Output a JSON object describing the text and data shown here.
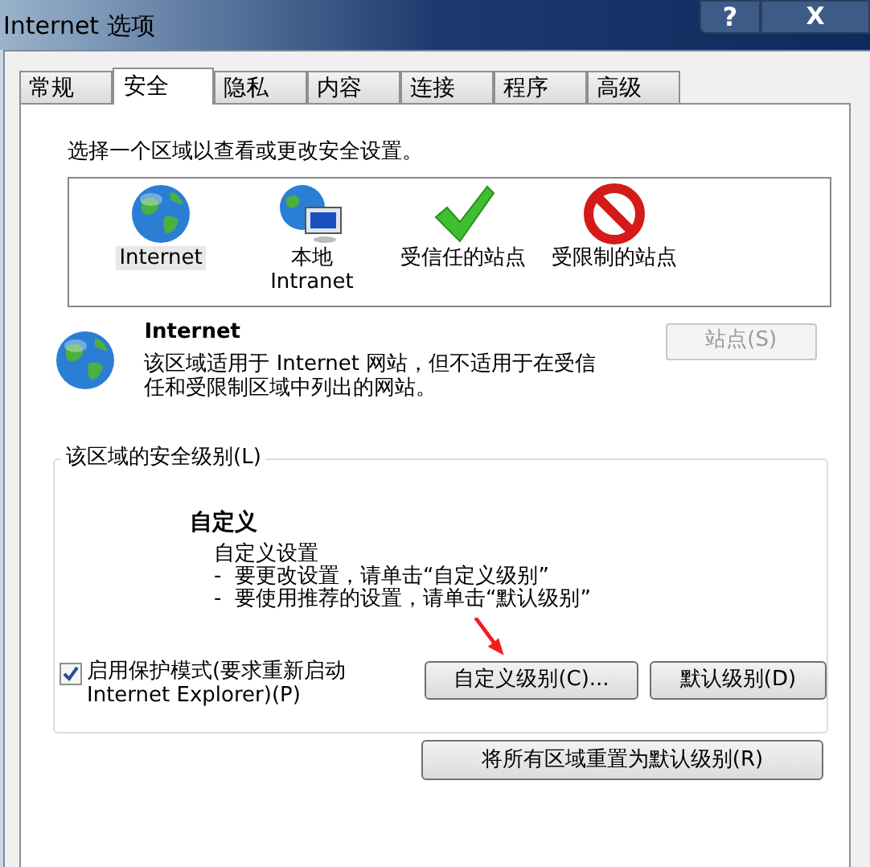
{
  "window": {
    "title": "Internet 选项",
    "help": "?",
    "close": "X"
  },
  "tabs": [
    {
      "label": "常规",
      "selected": false
    },
    {
      "label": "安全",
      "selected": true
    },
    {
      "label": "隐私",
      "selected": false
    },
    {
      "label": "内容",
      "selected": false
    },
    {
      "label": "连接",
      "selected": false
    },
    {
      "label": "程序",
      "selected": false
    },
    {
      "label": "高级",
      "selected": false
    }
  ],
  "instruction": "选择一个区域以查看或更改安全设置。",
  "zones": [
    {
      "kind": "globe",
      "lines": [
        "Internet"
      ],
      "selected": true
    },
    {
      "kind": "intranet",
      "lines": [
        "本地",
        "Intranet"
      ],
      "selected": false
    },
    {
      "kind": "trusted",
      "lines": [
        "受信任的站点"
      ],
      "selected": false
    },
    {
      "kind": "restricted",
      "lines": [
        "受限制的站点"
      ],
      "selected": false
    }
  ],
  "zone_info": {
    "title": "Internet",
    "description": "该区域适用于 Internet 网站，但不适用于在受信任和受限制区域中列出的网站。",
    "sites_button": {
      "label": "站点(S)",
      "disabled": true
    }
  },
  "security_level": {
    "legend": "该区域的安全级别(L)",
    "level_name": "自定义",
    "lines": [
      "自定义设置",
      "-  要更改设置，请单击“自定义级别”",
      "-  要使用推荐的设置，请单击“默认级别”"
    ],
    "protected_mode": {
      "label": "启用保护模式(要求重新启动 Internet Explorer)(P)",
      "checked": true
    },
    "buttons": [
      "自定义级别(C)...",
      "默认级别(D)"
    ]
  },
  "reset_button": "将所有区域重置为默认级别(R)"
}
